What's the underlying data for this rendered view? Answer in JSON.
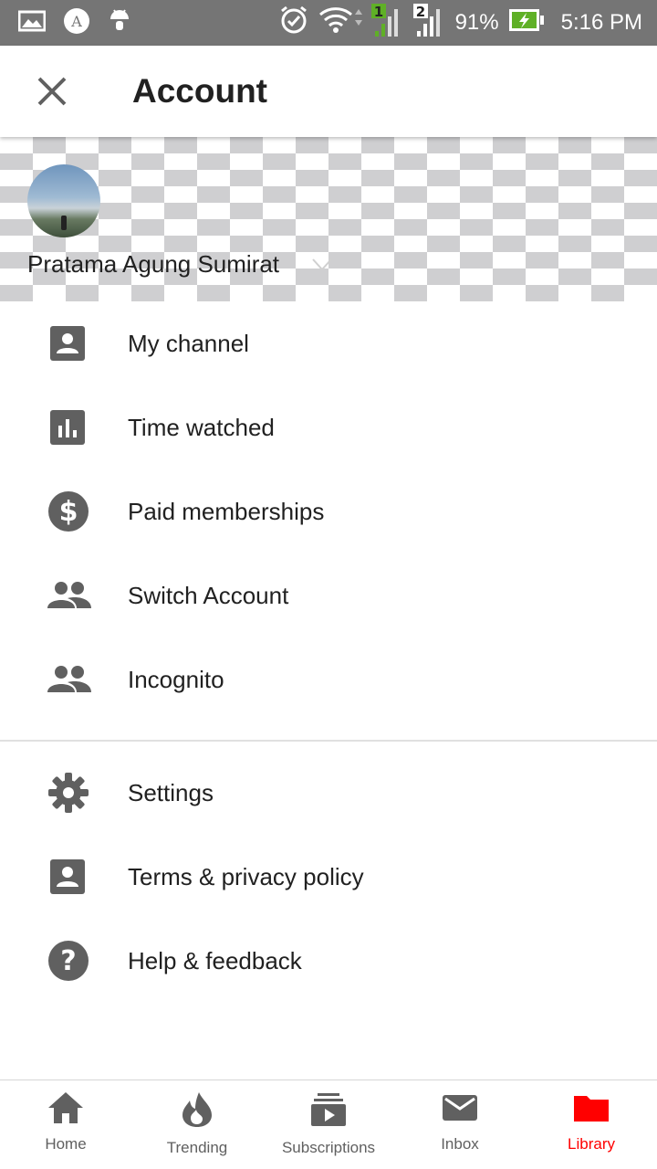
{
  "status_bar": {
    "battery": "91%",
    "time": "5:16 PM",
    "sim1": "1",
    "sim2": "2",
    "icons": [
      "image-icon",
      "a-circle-icon",
      "android-icon",
      "alarm-icon",
      "wifi-icon",
      "signal-icon",
      "battery-charging-icon"
    ]
  },
  "appbar": {
    "title": "Account",
    "close_icon": "close-icon"
  },
  "profile": {
    "name": "Pratama Agung Sumirat"
  },
  "menu": {
    "section1": [
      {
        "label": "My channel",
        "icon": "account-box-icon"
      },
      {
        "label": "Time watched",
        "icon": "bar-chart-icon"
      },
      {
        "label": "Paid memberships",
        "icon": "dollar-circle-icon"
      },
      {
        "label": "Switch Account",
        "icon": "people-icon"
      },
      {
        "label": "Incognito",
        "icon": "people-icon"
      }
    ],
    "section2": [
      {
        "label": "Settings",
        "icon": "gear-icon"
      },
      {
        "label": "Terms & privacy policy",
        "icon": "account-box-icon"
      },
      {
        "label": "Help & feedback",
        "icon": "help-circle-icon"
      }
    ]
  },
  "bottom_nav": [
    {
      "label": "Home",
      "icon": "home-icon"
    },
    {
      "label": "Trending",
      "icon": "flame-icon"
    },
    {
      "label": "Subscriptions",
      "icon": "subscriptions-icon"
    },
    {
      "label": "Inbox",
      "icon": "mail-icon"
    },
    {
      "label": "Library",
      "icon": "folder-icon"
    }
  ],
  "colors": {
    "accent": "#ff0000",
    "icon_grey": "#606060",
    "status_bar": "#757575"
  }
}
